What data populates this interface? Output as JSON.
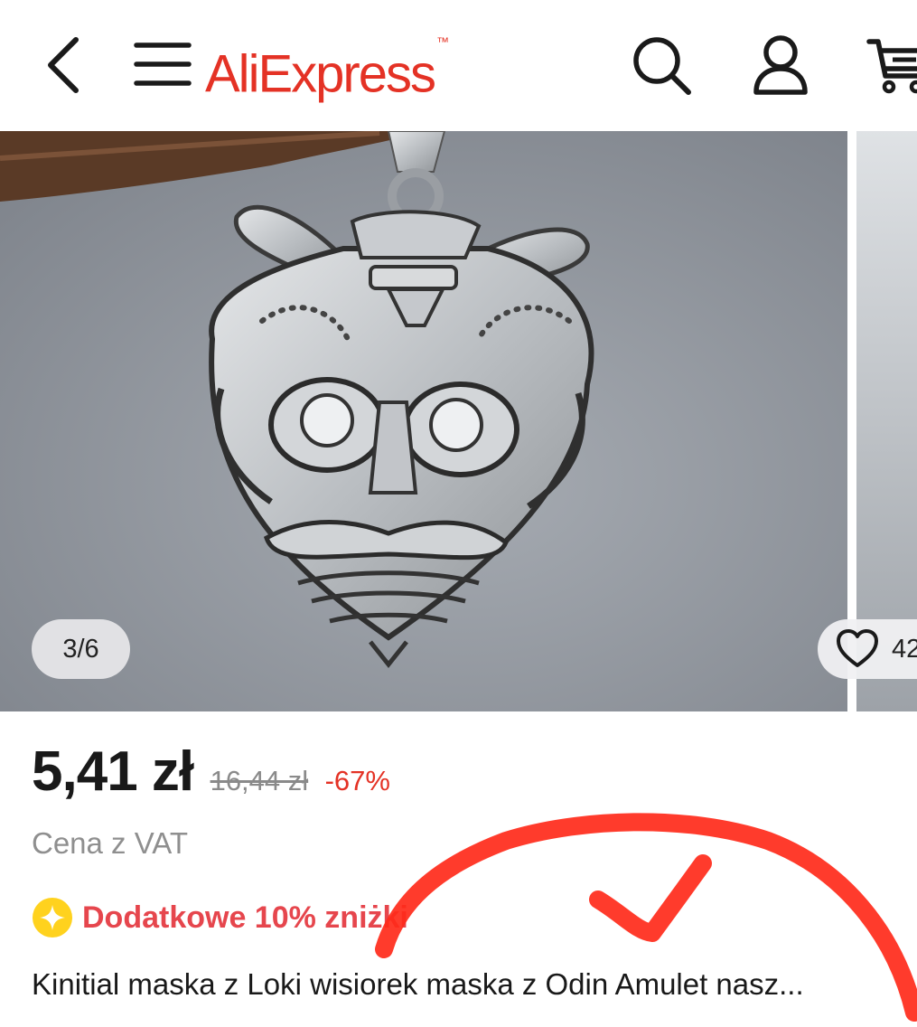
{
  "header": {
    "logo_text": "AliExpress",
    "logo_mark": "™",
    "brand_color": "#e43225",
    "icons": {
      "back": "chevron-left-icon",
      "menu": "hamburger-icon",
      "search": "search-icon",
      "account": "user-icon",
      "cart": "cart-icon"
    }
  },
  "gallery": {
    "counter": "3/6",
    "current_index": 3,
    "total": 6,
    "wishlist_count": "42",
    "background_color": "#8f949b"
  },
  "product": {
    "price_current": "5,41 zł",
    "price_old": "16,44 zł",
    "discount": "-67%",
    "vat_note": "Cena z VAT",
    "coupon_text": "Dodatkowe 10% zniżki",
    "title": "Kinitial maska z Loki wisiorek maska z Odin Amulet nasz..."
  },
  "colors": {
    "discount": "#e43225",
    "coupon": "#e6464d",
    "coupon_icon": "#ffd21e",
    "annotation": "#ff2a1a"
  }
}
